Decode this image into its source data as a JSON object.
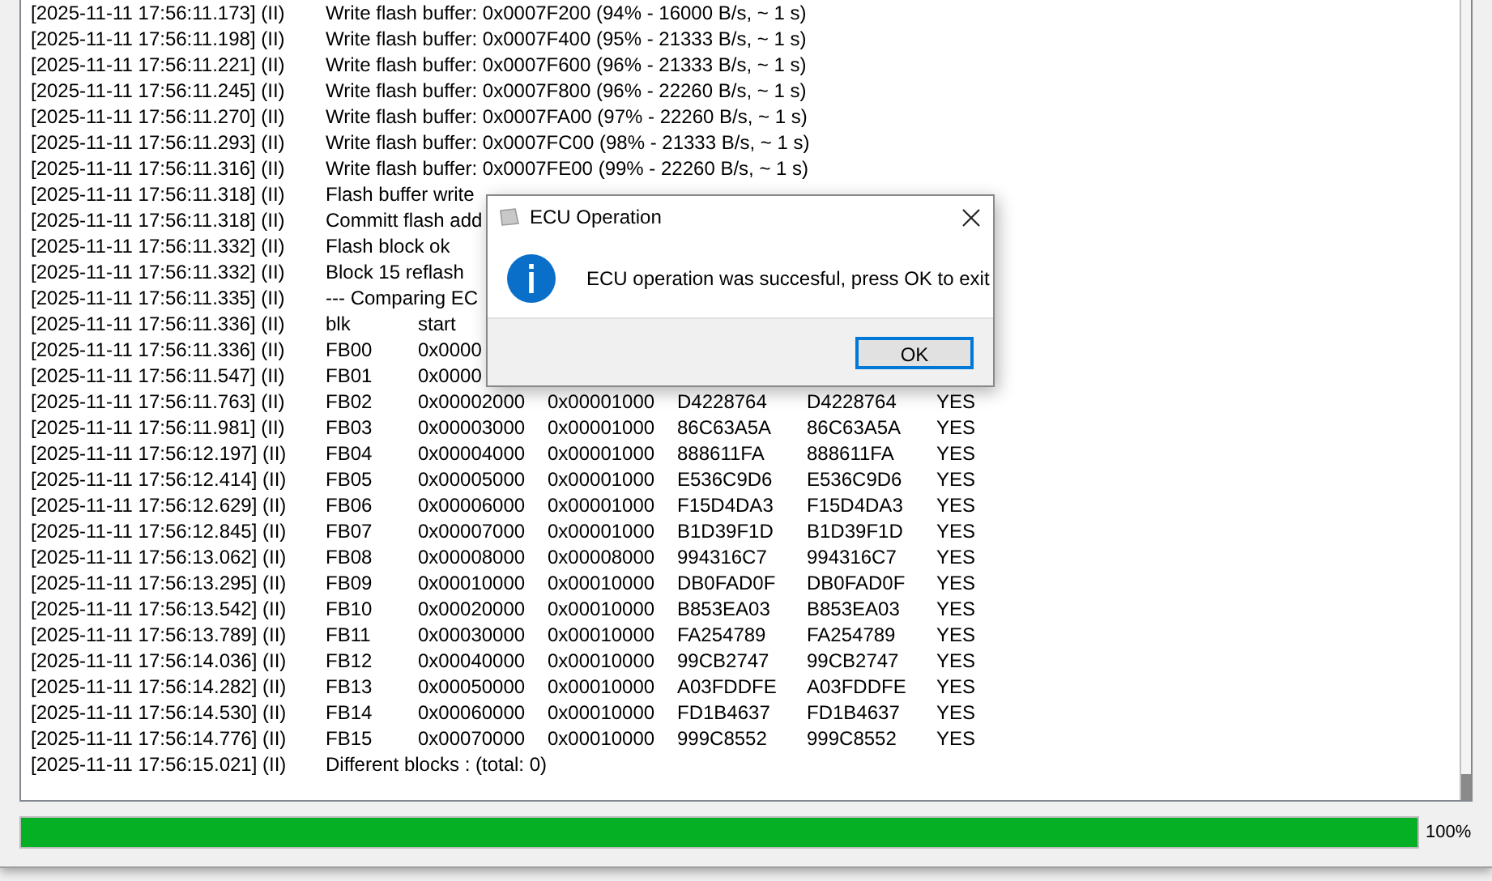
{
  "log": [
    {
      "prefix": "[2025-11-11 17:56:11.173] (II)",
      "cells": [
        "Write flash buffer: 0x0007F200 (94% - 16000 B/s, ~ 1 s)"
      ]
    },
    {
      "prefix": "[2025-11-11 17:56:11.198] (II)",
      "cells": [
        "Write flash buffer: 0x0007F400 (95% - 21333 B/s, ~ 1 s)"
      ]
    },
    {
      "prefix": "[2025-11-11 17:56:11.221] (II)",
      "cells": [
        "Write flash buffer: 0x0007F600 (96% - 21333 B/s, ~ 1 s)"
      ]
    },
    {
      "prefix": "[2025-11-11 17:56:11.245] (II)",
      "cells": [
        "Write flash buffer: 0x0007F800 (96% - 22260 B/s, ~ 1 s)"
      ]
    },
    {
      "prefix": "[2025-11-11 17:56:11.270] (II)",
      "cells": [
        "Write flash buffer: 0x0007FA00 (97% - 22260 B/s, ~ 1 s)"
      ]
    },
    {
      "prefix": "[2025-11-11 17:56:11.293] (II)",
      "cells": [
        "Write flash buffer: 0x0007FC00 (98% - 21333 B/s, ~ 1 s)"
      ]
    },
    {
      "prefix": "[2025-11-11 17:56:11.316] (II)",
      "cells": [
        "Write flash buffer: 0x0007FE00 (99% - 22260 B/s, ~ 1 s)"
      ]
    },
    {
      "prefix": "[2025-11-11 17:56:11.318] (II)",
      "cells": [
        "Flash buffer write"
      ]
    },
    {
      "prefix": "[2025-11-11 17:56:11.318] (II)",
      "cells": [
        "Committ flash add"
      ]
    },
    {
      "prefix": "[2025-11-11 17:56:11.332] (II)",
      "cells": [
        "Flash block ok"
      ]
    },
    {
      "prefix": "[2025-11-11 17:56:11.332] (II)",
      "cells": [
        "Block 15 reflash"
      ]
    },
    {
      "prefix": "[2025-11-11 17:56:11.335] (II)",
      "cells": [
        "--- Comparing EC"
      ]
    },
    {
      "prefix": "[2025-11-11 17:56:11.336] (II)",
      "cells": [
        "blk",
        "start"
      ]
    },
    {
      "prefix": "[2025-11-11 17:56:11.336] (II)",
      "cells": [
        "FB00",
        "0x0000"
      ]
    },
    {
      "prefix": "[2025-11-11 17:56:11.547] (II)",
      "cells": [
        "FB01",
        "0x0000"
      ]
    },
    {
      "prefix": "[2025-11-11 17:56:11.763] (II)",
      "cells": [
        "FB02",
        "0x00002000",
        "0x00001000",
        "D4228764",
        "D4228764",
        "YES"
      ]
    },
    {
      "prefix": "[2025-11-11 17:56:11.981] (II)",
      "cells": [
        "FB03",
        "0x00003000",
        "0x00001000",
        "86C63A5A",
        "86C63A5A",
        "YES"
      ]
    },
    {
      "prefix": "[2025-11-11 17:56:12.197] (II)",
      "cells": [
        "FB04",
        "0x00004000",
        "0x00001000",
        "888611FA",
        "888611FA",
        "YES"
      ]
    },
    {
      "prefix": "[2025-11-11 17:56:12.414] (II)",
      "cells": [
        "FB05",
        "0x00005000",
        "0x00001000",
        "E536C9D6",
        "E536C9D6",
        "YES"
      ]
    },
    {
      "prefix": "[2025-11-11 17:56:12.629] (II)",
      "cells": [
        "FB06",
        "0x00006000",
        "0x00001000",
        "F15D4DA3",
        "F15D4DA3",
        "YES"
      ]
    },
    {
      "prefix": "[2025-11-11 17:56:12.845] (II)",
      "cells": [
        "FB07",
        "0x00007000",
        "0x00001000",
        "B1D39F1D",
        "B1D39F1D",
        "YES"
      ]
    },
    {
      "prefix": "[2025-11-11 17:56:13.062] (II)",
      "cells": [
        "FB08",
        "0x00008000",
        "0x00008000",
        "994316C7",
        "994316C7",
        "YES"
      ]
    },
    {
      "prefix": "[2025-11-11 17:56:13.295] (II)",
      "cells": [
        "FB09",
        "0x00010000",
        "0x00010000",
        "DB0FAD0F",
        "DB0FAD0F",
        "YES"
      ]
    },
    {
      "prefix": "[2025-11-11 17:56:13.542] (II)",
      "cells": [
        "FB10",
        "0x00020000",
        "0x00010000",
        "B853EA03",
        "B853EA03",
        "YES"
      ]
    },
    {
      "prefix": "[2025-11-11 17:56:13.789] (II)",
      "cells": [
        "FB11",
        "0x00030000",
        "0x00010000",
        "FA254789",
        "FA254789",
        "YES"
      ]
    },
    {
      "prefix": "[2025-11-11 17:56:14.036] (II)",
      "cells": [
        "FB12",
        "0x00040000",
        "0x00010000",
        "99CB2747",
        "99CB2747",
        "YES"
      ]
    },
    {
      "prefix": "[2025-11-11 17:56:14.282] (II)",
      "cells": [
        "FB13",
        "0x00050000",
        "0x00010000",
        "A03FDDFE",
        "A03FDDFE",
        "YES"
      ]
    },
    {
      "prefix": "[2025-11-11 17:56:14.530] (II)",
      "cells": [
        "FB14",
        "0x00060000",
        "0x00010000",
        "FD1B4637",
        "FD1B4637",
        "YES"
      ]
    },
    {
      "prefix": "[2025-11-11 17:56:14.776] (II)",
      "cells": [
        "FB15",
        "0x00070000",
        "0x00010000",
        "999C8552",
        "999C8552",
        "YES"
      ]
    },
    {
      "prefix": "[2025-11-11 17:56:15.021] (II)",
      "cells": [
        "Different blocks :  (total: 0)"
      ]
    }
  ],
  "progress": {
    "level": 1,
    "label": "100%"
  },
  "dialog": {
    "title": "ECU Operation",
    "message": "ECU operation was succesful, press OK to exit",
    "buttons": [
      {
        "label": "OK",
        "selected": true
      }
    ]
  }
}
